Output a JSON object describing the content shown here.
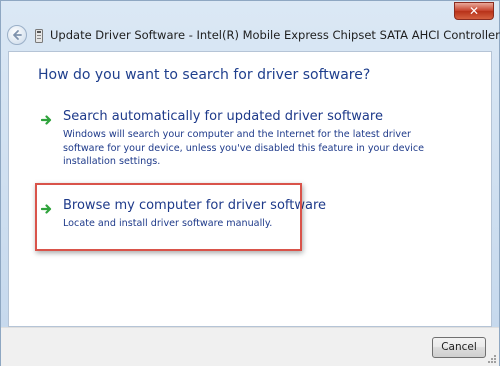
{
  "window": {
    "title": "Update Driver Software - Intel(R) Mobile Express Chipset SATA AHCI Controller",
    "close_label": "✕"
  },
  "main": {
    "heading": "How do you want to search for driver software?",
    "options": [
      {
        "title": "Search automatically for updated driver software",
        "description": "Windows will search your computer and the Internet for the latest driver software for your device, unless you've disabled this feature in your device installation settings."
      },
      {
        "title": "Browse my computer for driver software",
        "description": "Locate and install driver software manually."
      }
    ]
  },
  "footer": {
    "cancel_label": "Cancel"
  },
  "icons": {
    "back": "back-arrow-icon",
    "dialog": "device-icon",
    "option_arrow": "green-arrow-icon",
    "close": "close-icon",
    "grip": "resize-grip-icon"
  },
  "colors": {
    "heading": "#1f3f8d",
    "option_text": "#1e3a8a",
    "arrow": "#2fa33c",
    "highlight": "#d9534a",
    "close_button": "#c7442e"
  }
}
